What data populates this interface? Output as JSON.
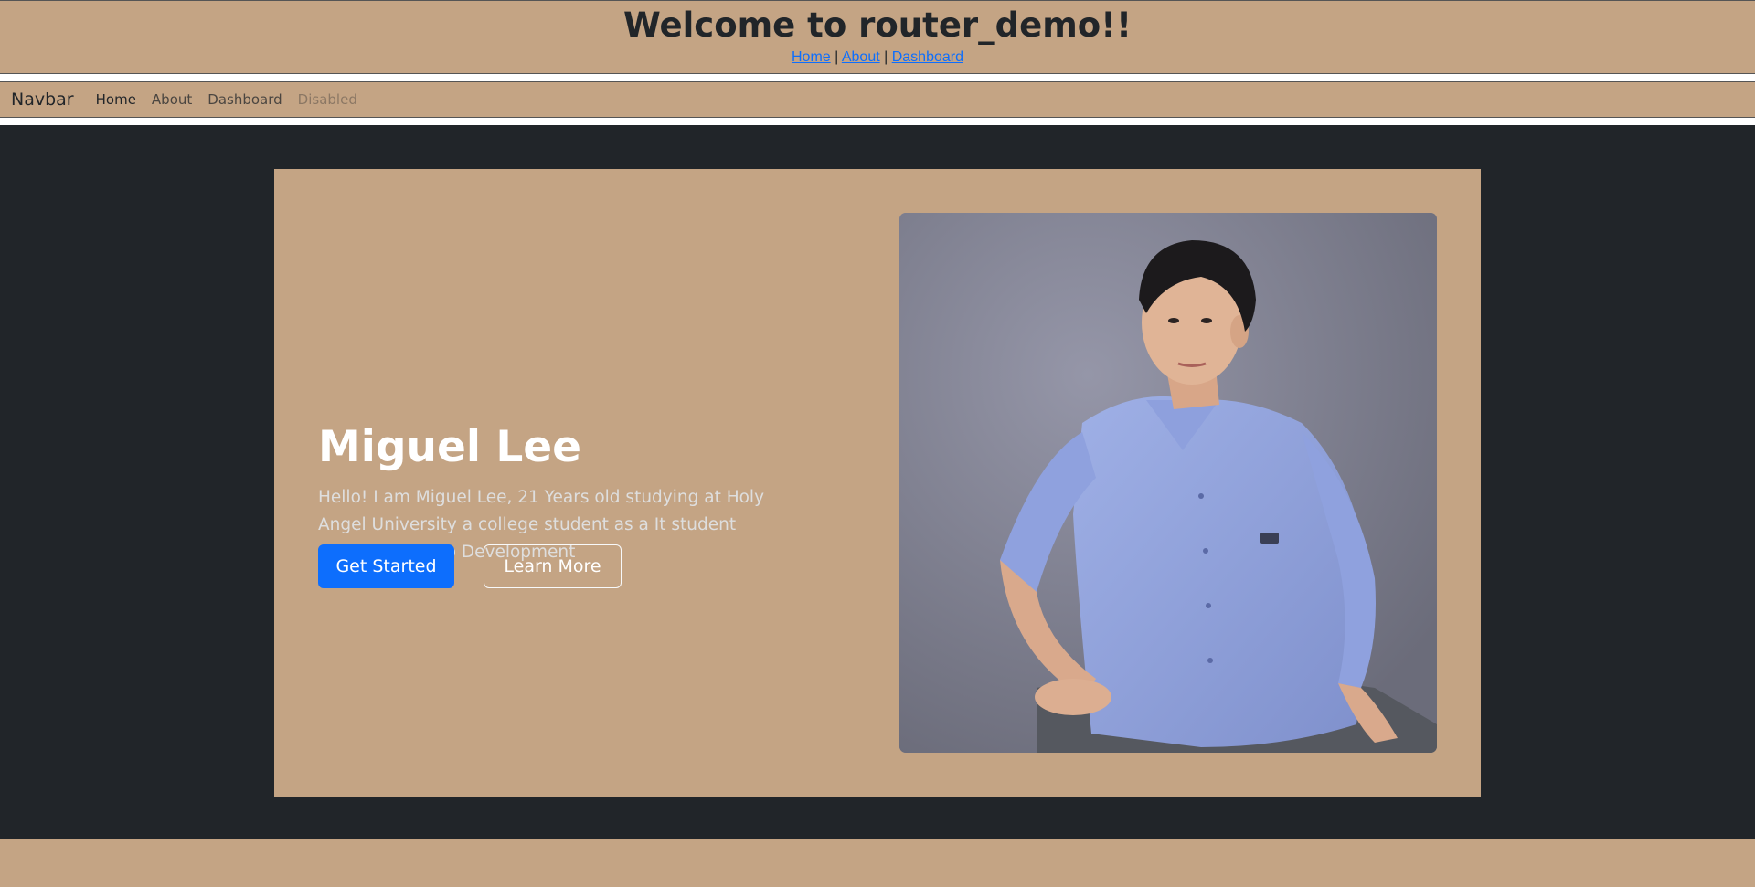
{
  "header": {
    "title": "Welcome to router_demo!!",
    "links": [
      {
        "label": "Home"
      },
      {
        "label": "About"
      },
      {
        "label": "Dashboard"
      }
    ],
    "separator": "|"
  },
  "navbar": {
    "brand": "Navbar",
    "items": [
      {
        "label": "Home",
        "state": "active"
      },
      {
        "label": "About",
        "state": "normal"
      },
      {
        "label": "Dashboard",
        "state": "normal"
      },
      {
        "label": "Disabled",
        "state": "disabled"
      }
    ]
  },
  "hero": {
    "title": "Miguel Lee",
    "lead": "Hello! I am Miguel Lee, 21 Years old studying at Holy Angel University a college student as a It student majoring in Web Development",
    "primary_button": "Get Started",
    "secondary_button": "Learn More"
  },
  "colors": {
    "accent_tan": "#c4a484",
    "dark_bg": "#212529",
    "primary_blue": "#0d6efd"
  }
}
